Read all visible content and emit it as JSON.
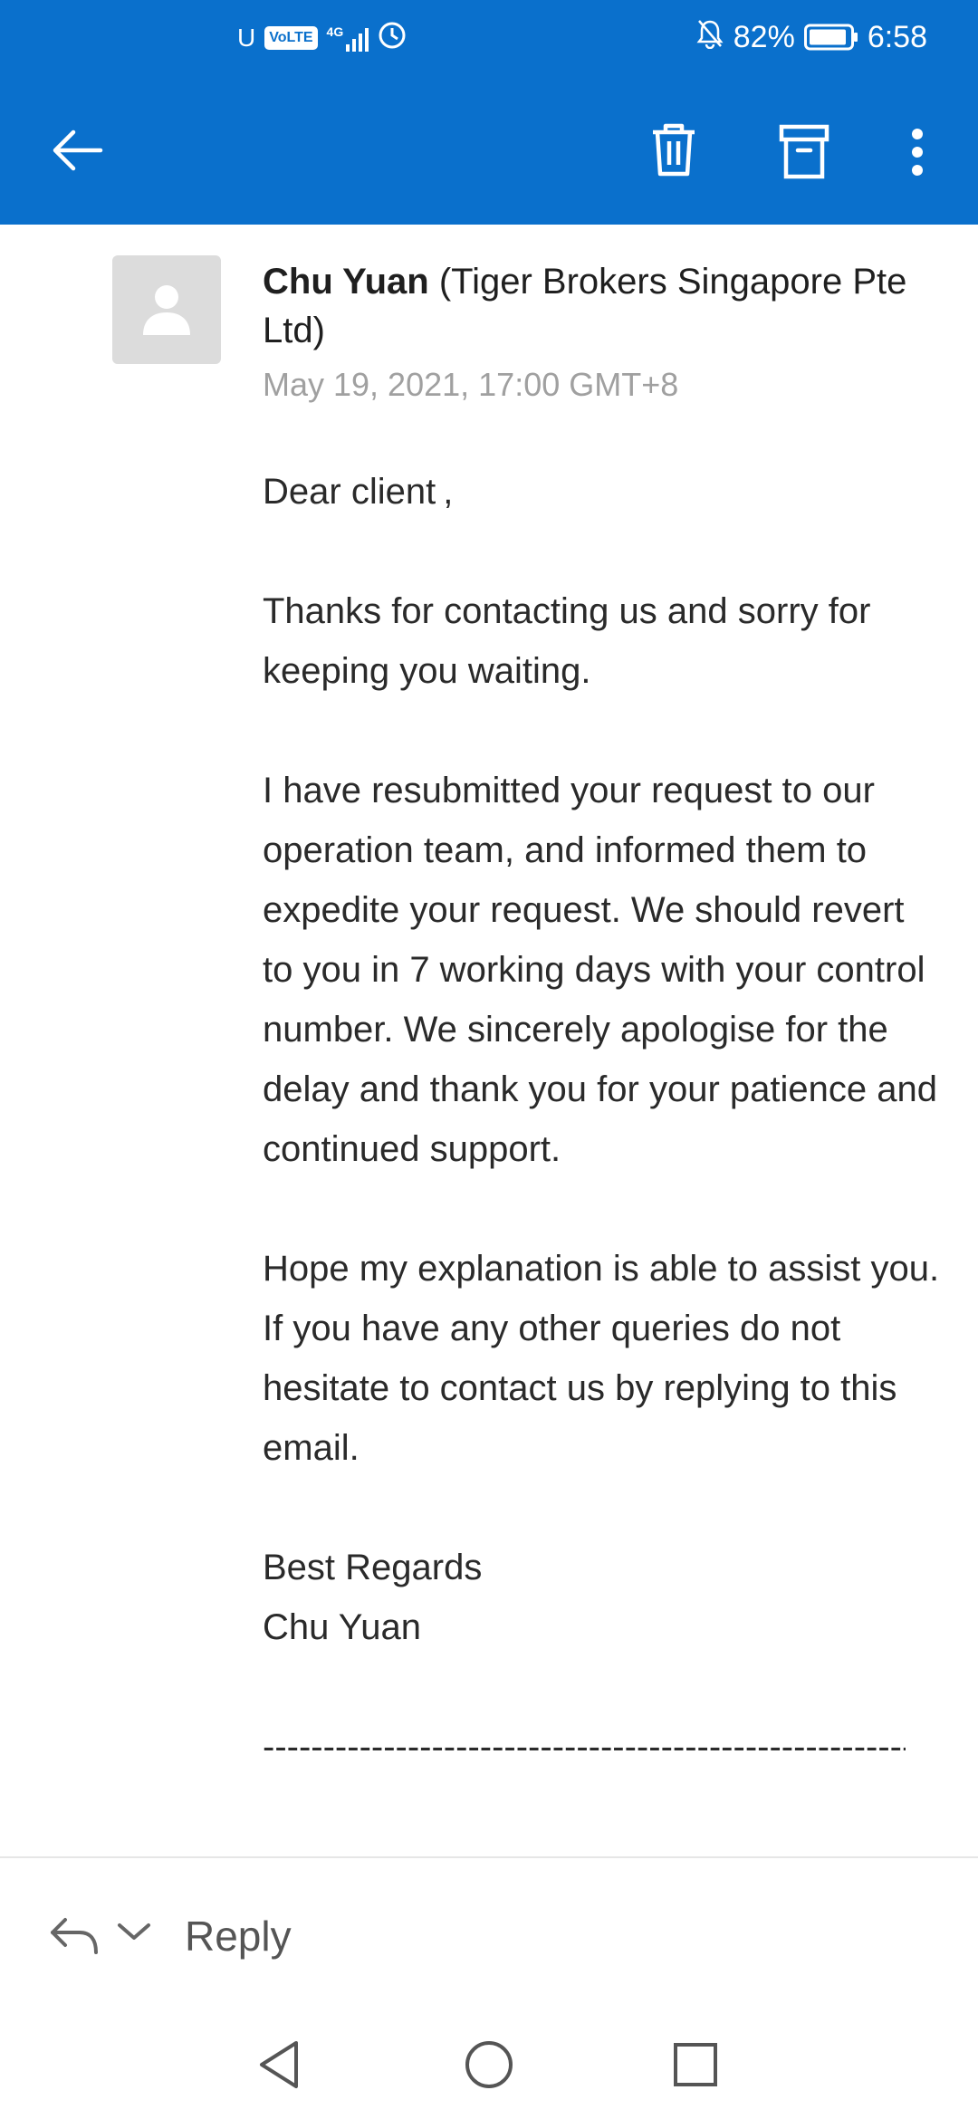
{
  "status_bar": {
    "carrier_indicator": "U",
    "volte": "VoLTE",
    "network": "4G",
    "battery_percent": "82%",
    "time": "6:58",
    "icons": [
      "signal-icon",
      "data-saver-icon",
      "mute-icon",
      "battery-icon"
    ]
  },
  "appbar": {
    "back_icon": "back-arrow-icon",
    "delete_icon": "trash-icon",
    "archive_icon": "archive-icon",
    "more_icon": "more-vertical-icon",
    "background": "#0a70cc"
  },
  "message": {
    "sender_name": "Chu Yuan",
    "sender_org": " (Tiger Brokers Singapore Pte Ltd)",
    "timestamp": "May 19, 2021, 17:00 GMT+8",
    "greeting": "Dear client ,",
    "para1": "Thanks for contacting us and sorry for keeping you waiting.",
    "para2": "I have resubmitted your request to our operation team, and informed them to expedite your request. We should revert to you in 7 working days with your control number. We sincerely apologise for the delay and thank you for your patience and continued support.",
    "para3": "Hope my explanation is able to assist you. If you have any other queries do not hesitate to contact us by replying to this email.",
    "signoff": "Best Regards",
    "signature": "Chu Yuan",
    "separator": "------------------------------------------------------------------"
  },
  "reply_bar": {
    "reply_label": "Reply",
    "reply_icon": "reply-icon",
    "chevron_icon": "chevron-down-icon"
  },
  "nav_bar": {
    "back_icon": "nav-back-icon",
    "home_icon": "nav-home-icon",
    "recents_icon": "nav-recents-icon"
  }
}
